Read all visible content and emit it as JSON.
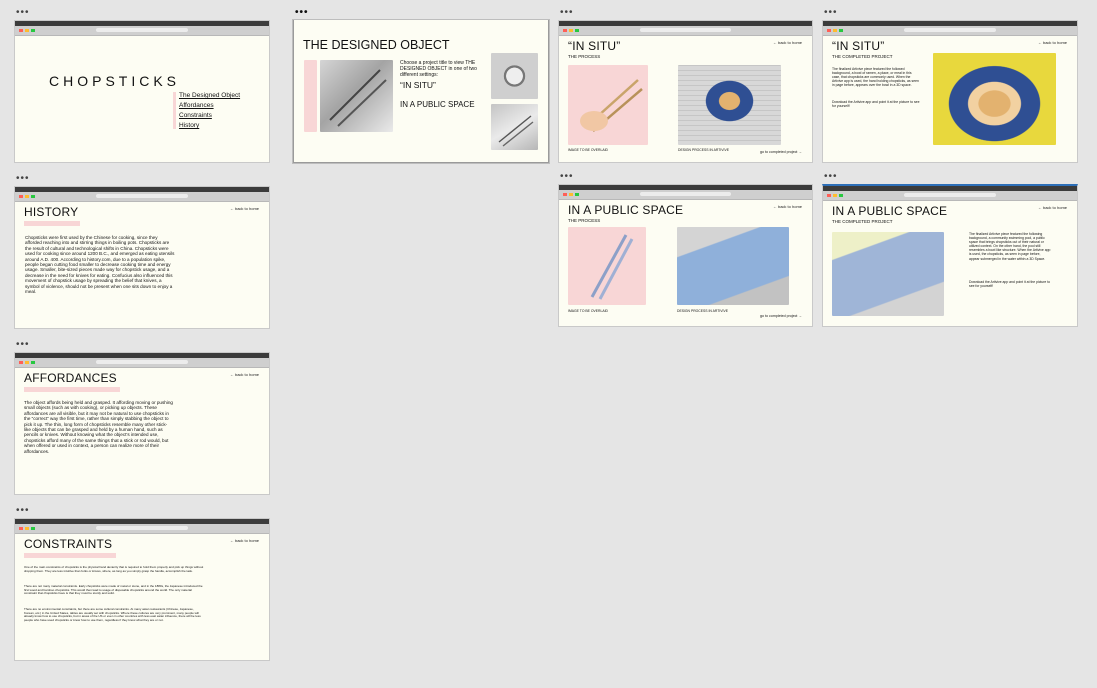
{
  "frames": {
    "home": {
      "title": "CHOPSTICKS",
      "nav": [
        "The Designed Object",
        "Affordances",
        "Constraints",
        "History"
      ]
    },
    "designed": {
      "title": "THE DESIGNED OBJECT",
      "intro": "Choose a project title to view THE DESIGNED OBJECT in one of two different settings:",
      "option1": "“IN SITU”",
      "option2": "IN A PUBLIC SPACE"
    },
    "insitu_process": {
      "title": "“IN SITU”",
      "subtitle": "THE PROCESS",
      "back": "← back to home",
      "caption_left": "IMAGE TO BE OVERLAID",
      "caption_right": "DESIGN PROCESS IN ARTIVIVE",
      "next": "go to completed project →"
    },
    "insitu_completed": {
      "title": "“IN SITU”",
      "subtitle": "THE COMPLETED PROJECT",
      "back": "← back to home",
      "body": "The finalized Artivive piece featured the followed background, a bowl of ramen, a place, or meal in this case, that chopsticks are commonly used. When the Artivive app is used, the hand holding chopsticks, as seen in page before, appears over the bowl in a 3D space.",
      "download": "Download the Artivive app and point it at the picture to see for yourself!"
    },
    "history": {
      "title": "HISTORY",
      "back": "← back to home",
      "body": "Chopsticks were first used by the Chinese for cooking, since they afforded reaching into and stirring things in boiling pots. Chopsticks are the result of cultural and technological shifts in China. Chopsticks were used for cooking since around 1200 B.C., and emerged as eating utensils around A.D. 400. According to history.com, due to a population spike, people began cutting food smaller to decrease cooking time and energy usage. Smaller, bite-sized pieces made way for chopstick usage, and a decrease in the need for knives for eating. Confucius also influenced this movement of chopstick usage by spreading the belief that knives, a symbol of violence, should not be present when one sits down to enjoy a meal."
    },
    "public_process": {
      "title": "IN A PUBLIC SPACE",
      "subtitle": "THE PROCESS",
      "back": "← back to home",
      "caption_left": "IMAGE TO BE OVERLAID",
      "caption_right": "DESIGN PROCESS IN ARTIVIVE",
      "next": "go to completed project →"
    },
    "public_completed": {
      "title": "IN A PUBLIC SPACE",
      "subtitle": "THE COMPLETED PROJECT",
      "back": "← back to home",
      "body": "The finalized Artivive piece featured the following background, a community swimming pool, a public space that brings chopsticks out of their natural or utilized context. On the other hand, the pool still resembles a bowl like structure. When the Artivive app is used, the chopsticks, as seen in page before, appear submerged in the water within a 3D Space.",
      "download": "Download the Artivive app and point it at the picture to see for yourself!"
    },
    "affordances": {
      "title": "AFFORDANCES",
      "back": "← back to home",
      "body": "The object affords being held and grasped. It affording moving or pushing small objects (such as with cooking), or picking up objects. These affordances are all visible, but it may not be natural to use chopsticks in the “correct” way the first time, rather than simply stabbing the object to pick it up. The thin, long form of chopsticks resemble many other stick-like objects that can be grasped and held by a human hand, such as pencils or knives. Without knowing what the object’s intended use, chopsticks afford many of the same things that a stick or rod would, but when offered or used in context, a person can realize more of their affordances."
    },
    "constraints": {
      "title": "CONSTRAINTS",
      "back": "← back to home",
      "p1": "One of the main constraints of chopsticks is the physical hand dexterity that is required to hold them properly and pick up things without dropping them. They are less intuitive than forks or knives, where, as long as you simply grasp the handle, accomplish the task.",
      "p2": "There are not many material constraints. Early chopsticks were made of metal or stone, and in the 1880s, the Japanese introduced the first wood and bamboo chopsticks. This would then lead to usage of disposable chopsticks around the world. The only material constraint that chopsticks have is that they must be sturdy and solid.",
      "p3": "There are no environmental constraints, but there are some cultural constraints. At many asian restaurants (Chinese, Japanese, Korean, etc.) in the United States, tables are usually set with chopsticks. Where these cultures are very prominent, many people will already know how to use chopsticks, but in areas of the US or even in other countries with less east asian influence, there will be less people who have used chopsticks or know how to use them, regardless if they know what they are or not."
    }
  }
}
